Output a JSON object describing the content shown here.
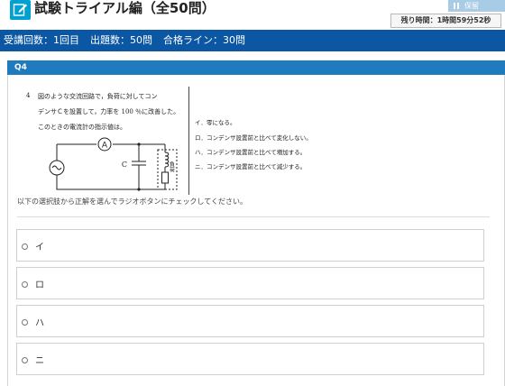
{
  "header": {
    "title": "試験トライアル編（全50問）",
    "hold_label": "保留",
    "timer_text": "残り時間：1時間59分52秒"
  },
  "info": {
    "attempt": "受講回数：1回目",
    "count": "出題数：50問",
    "pass_line": "合格ライン：30問"
  },
  "question": {
    "number_label": "Q4",
    "figure_number": "4",
    "stem": [
      "図のような交流回路で，負荷に対してコン",
      "デンサＣを設置して，力率を 100 ％に改善した。",
      "このときの電流計の指示値は。"
    ],
    "choices_text": [
      "イ．零になる。",
      "ロ．コンデンサ設置前と比べて変化しない。",
      "ハ．コンデンサ設置前と比べて増加する。",
      "ニ．コンデンサ設置前と比べて減少する。"
    ],
    "circuit_labels": {
      "ammeter": "A",
      "capacitor": "C",
      "load": "負荷"
    },
    "instruction": "以下の選択肢から正解を選んでラジオボタンにチェックしてください。"
  },
  "options": [
    {
      "label": "イ"
    },
    {
      "label": "ロ"
    },
    {
      "label": "ハ"
    },
    {
      "label": "ニ"
    }
  ],
  "colors": {
    "accent": "#0b57a4",
    "question_bar": "#1e7bbd",
    "icon": "#00a0d0",
    "hold_button": "#a8cbe6"
  }
}
